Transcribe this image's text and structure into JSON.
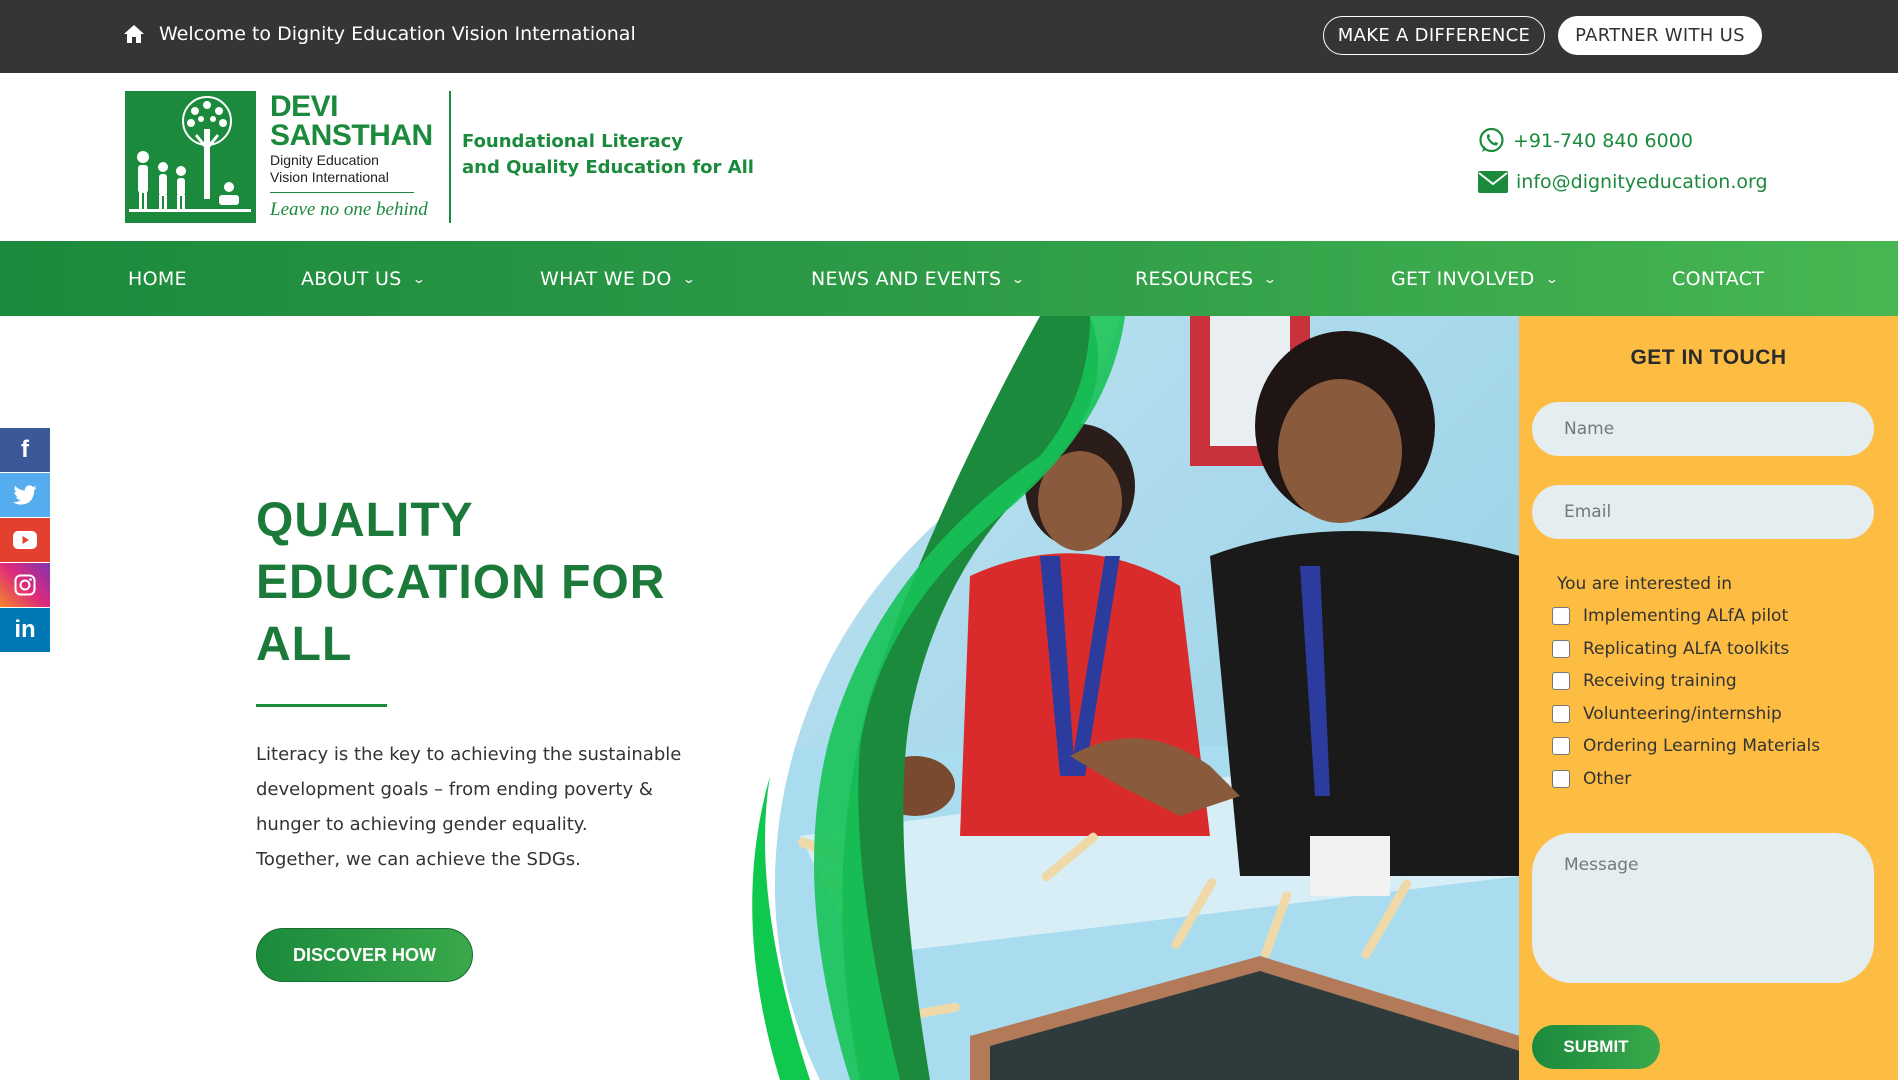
{
  "topbar": {
    "welcome": "Welcome to Dignity Education Vision International",
    "make_difference": "MAKE A DIFFERENCE",
    "partner": "PARTNER WITH US"
  },
  "header": {
    "logo_line1": "DEVI",
    "logo_line2": "SANSTHAN",
    "logo_sub1": "Dignity Education",
    "logo_sub2": "Vision International",
    "logo_motto": "Leave no one behind",
    "tagline1": "Foundational Literacy",
    "tagline2": "and Quality Education for All",
    "phone": "+91-740 840 6000",
    "email": "info@dignityeducation.org"
  },
  "nav": {
    "items": [
      {
        "label": "HOME",
        "dropdown": false
      },
      {
        "label": "ABOUT US",
        "dropdown": true
      },
      {
        "label": "WHAT WE DO",
        "dropdown": true
      },
      {
        "label": "NEWS AND EVENTS",
        "dropdown": true
      },
      {
        "label": "RESOURCES",
        "dropdown": true
      },
      {
        "label": "GET INVOLVED",
        "dropdown": true
      },
      {
        "label": "CONTACT",
        "dropdown": false
      }
    ]
  },
  "hero": {
    "title_line1": "QUALITY",
    "title_line2": "EDUCATION FOR",
    "title_line3": "ALL",
    "text_line1": "Literacy is the key to achieving the sustainable",
    "text_line2": "development goals – from ending poverty &",
    "text_line3": "hunger to achieving gender equality.",
    "text_line4": "Together, we can achieve the SDGs.",
    "cta": "DISCOVER HOW"
  },
  "social": {
    "icons": [
      "facebook-icon",
      "twitter-icon",
      "youtube-icon",
      "instagram-icon",
      "linkedin-icon"
    ],
    "colors": [
      "#3b5998",
      "#55acee",
      "#e4402f",
      "#c13584",
      "#0077b5"
    ]
  },
  "form": {
    "title": "GET IN TOUCH",
    "name_placeholder": "Name",
    "email_placeholder": "Email",
    "interest_label": "You are interested in",
    "options": [
      "Implementing ALfA pilot",
      "Replicating ALfA toolkits",
      "Receiving training",
      "Volunteering/internship",
      "Ordering Learning Materials",
      "Other"
    ],
    "message_placeholder": "Message",
    "submit": "SUBMIT"
  },
  "colors": {
    "brand_green": "#1b8a3c",
    "topbar": "#353535",
    "form_bg": "#fdbd43"
  }
}
